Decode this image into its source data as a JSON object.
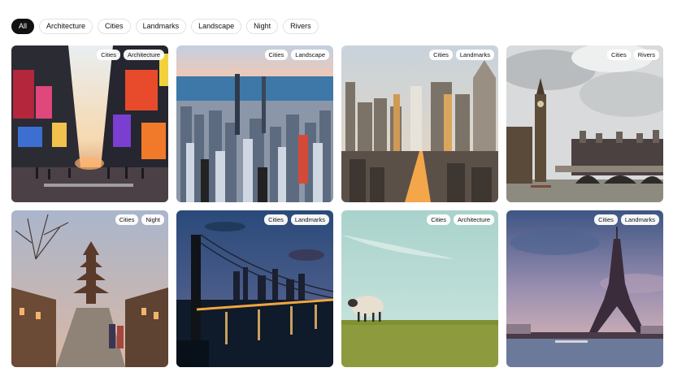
{
  "filters": {
    "items": [
      "All",
      "Architecture",
      "Cities",
      "Landmarks",
      "Landscape",
      "Night",
      "Rivers"
    ],
    "active": "All"
  },
  "gallery": {
    "cards": [
      {
        "scene": "times-square",
        "tags": [
          "Cities",
          "Architecture"
        ]
      },
      {
        "scene": "chicago-aerial",
        "tags": [
          "Cities",
          "Landscape"
        ]
      },
      {
        "scene": "nyc-skyline",
        "tags": [
          "Cities",
          "Landmarks"
        ]
      },
      {
        "scene": "big-ben-river",
        "tags": [
          "Cities",
          "Rivers"
        ]
      },
      {
        "scene": "kyoto-pagoda",
        "tags": [
          "Cities",
          "Night"
        ]
      },
      {
        "scene": "bridge-night",
        "tags": [
          "Cities",
          "Landmarks"
        ]
      },
      {
        "scene": "sheep-field",
        "tags": [
          "Cities",
          "Architecture"
        ]
      },
      {
        "scene": "eiffel-tower",
        "tags": [
          "Cities",
          "Landmarks"
        ]
      }
    ]
  }
}
